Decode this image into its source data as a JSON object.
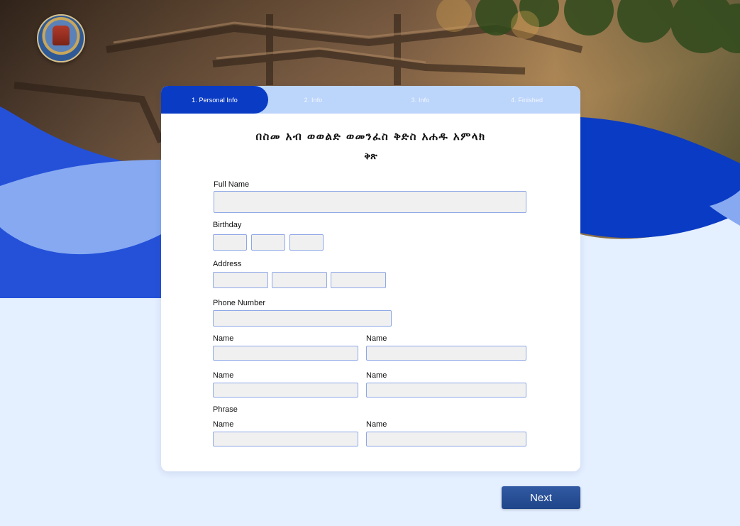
{
  "steps": [
    {
      "label": "1. Personal Info"
    },
    {
      "label": "2.  Info"
    },
    {
      "label": "3.  Info"
    },
    {
      "label": "4.  Finished"
    }
  ],
  "form": {
    "title_line1": "በስመ አብ ወወልድ ወመንፈስ ቅድስ አሐዱ አምላክ",
    "title_line2": "ቅጽ",
    "full_name_label": "Full Name",
    "birthday_label": "Birthday",
    "address_label": "Address",
    "phone_label": "Phone Number",
    "name_label": "Name",
    "phrase_label": "Phrase"
  },
  "buttons": {
    "next_label": "Next"
  },
  "colors": {
    "accent": "#0a3bc4",
    "step_inactive": "#bcd5fb",
    "page_bg": "#e4efff",
    "button": "#2a4f96"
  }
}
